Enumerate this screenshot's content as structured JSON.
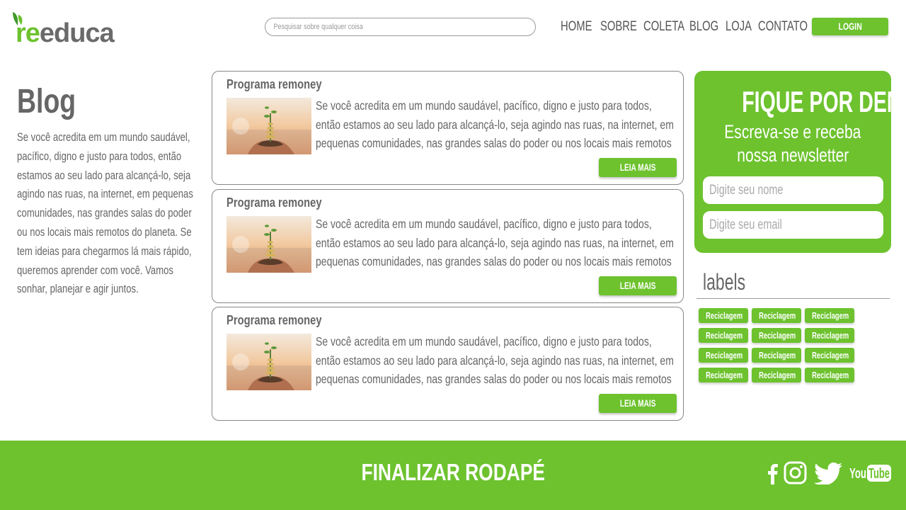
{
  "header": {
    "logo": {
      "prefix": "re",
      "suffix": "educa"
    },
    "search_placeholder": "Pesquisar sobre qualquer coisa",
    "nav": [
      "HOME",
      "SOBRE",
      "COLETA",
      "BLOG",
      "LOJA",
      "CONTATO"
    ],
    "login_label": "LOGIN"
  },
  "intro": {
    "title": "Blog",
    "description": "Se você acredita em um mundo saudável, pacífico, digno e justo para todos, então estamos ao seu lado para alcançá-lo, seja agindo nas ruas, na internet, em pequenas comunidades, nas grandes salas do poder ou nos locais mais remotos do planeta. Se tem ideias para chegarmos lá mais rápido, queremos aprender com você. Vamos sonhar, planejar e agir juntos."
  },
  "posts": [
    {
      "title": "Programa remoney",
      "text": "Se você acredita em um mundo saudável, pacífico, digno e justo para todos, então estamos ao seu lado para alcançá-lo, seja agindo nas ruas, na internet, em pequenas comunidades, nas grandes salas do poder ou nos locais mais remotos do planeta. Se",
      "button": "LEIA MAIS"
    },
    {
      "title": "Programa remoney",
      "text": "Se você acredita em um mundo saudável, pacífico, digno e justo para todos, então estamos ao seu lado para alcançá-lo, seja agindo nas ruas, na internet, em pequenas comunidades, nas grandes salas do poder ou nos locais mais remotos do planeta. Se",
      "button": "LEIA MAIS"
    },
    {
      "title": "Programa remoney",
      "text": "Se você acredita em um mundo saudável, pacífico, digno e justo para todos, então estamos ao seu lado para alcançá-lo, seja agindo nas ruas, na internet, em pequenas comunidades, nas grandes salas do poder ou nos locais mais remotos do planeta. Se",
      "button": "LEIA MAIS"
    }
  ],
  "newsletter": {
    "title": "FIQUE POR DENTRO",
    "subtitle_line1": "Escreva-se e receba",
    "subtitle_line2": "nossa newsletter",
    "name_placeholder": "Digite seu nome",
    "email_placeholder": "Digite seu email"
  },
  "labels": {
    "title": "labels",
    "tags": [
      "Reciclagem",
      "Reciclagem",
      "Reciclagem",
      "Reciclagem",
      "Reciclagem",
      "Reciclagem",
      "Reciclagem",
      "Reciclagem",
      "Reciclagem",
      "Reciclagem",
      "Reciclagem",
      "Reciclagem"
    ]
  },
  "footer": {
    "text": "FINALIZAR RODAPÉ",
    "social_icons": [
      "facebook-icon",
      "instagram-icon",
      "twitter-icon",
      "youtube-icon"
    ],
    "youtube_label": {
      "you": "You",
      "tube": "Tube"
    }
  },
  "colors": {
    "accent": "#6dc22e",
    "text": "#666666"
  }
}
